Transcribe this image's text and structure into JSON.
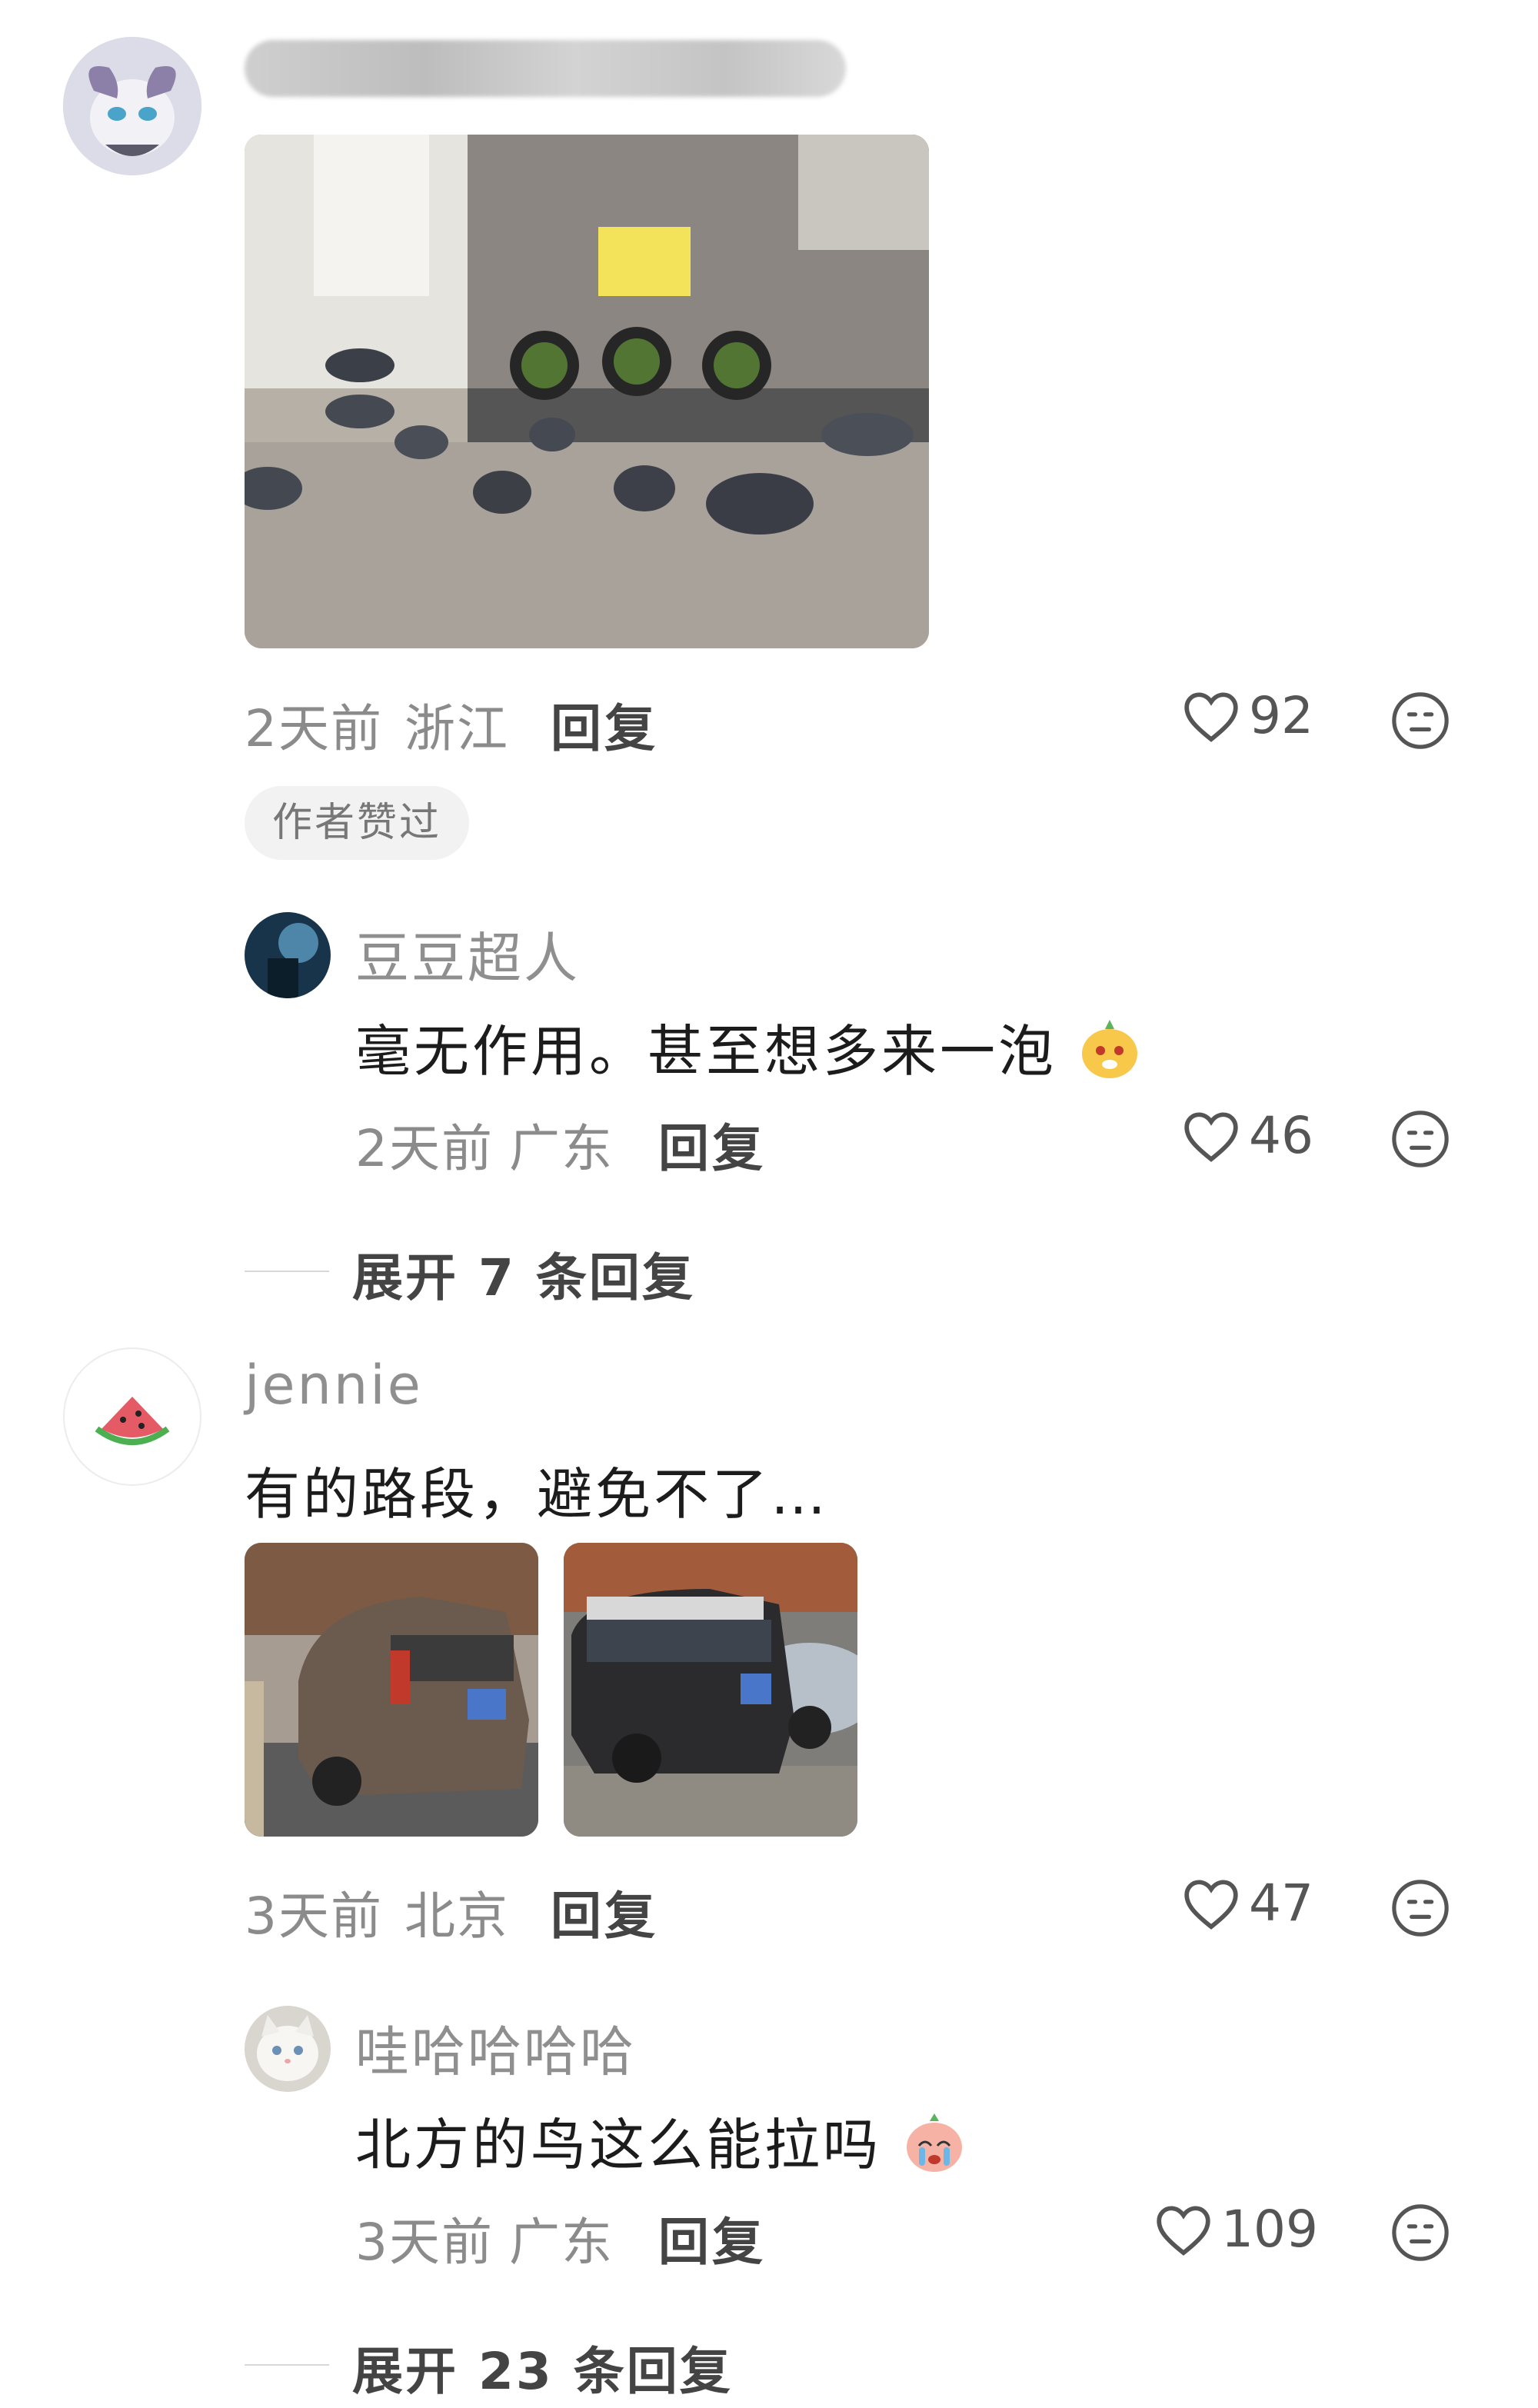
{
  "comments": [
    {
      "username": "",
      "time": "2天前",
      "location": "浙江",
      "reply_label": "回复",
      "likes": "92",
      "badge": "作者赞过"
    },
    {
      "username": "jennie",
      "text": "有的路段，避免不了…",
      "time": "3天前",
      "location": "北京",
      "reply_label": "回复",
      "likes": "47"
    }
  ],
  "replies": [
    {
      "username": "豆豆超人",
      "text": "毫无作用。甚至想多来一泡",
      "time": "2天前",
      "location": "广东",
      "reply_label": "回复",
      "likes": "46"
    },
    {
      "username": "哇哈哈哈哈",
      "text": "北方的鸟这么能拉吗",
      "time": "3天前",
      "location": "广东",
      "reply_label": "回复",
      "likes": "109"
    }
  ],
  "expand": [
    {
      "label": "展开 7 条回复"
    },
    {
      "label": "展开 23 条回复"
    }
  ],
  "icons": {
    "like": "heart-outline-icon",
    "dislike": "unhappy-face-icon"
  },
  "colors": {
    "meta_text": "#8b8b8b",
    "badge_bg": "#f2f2f2"
  }
}
